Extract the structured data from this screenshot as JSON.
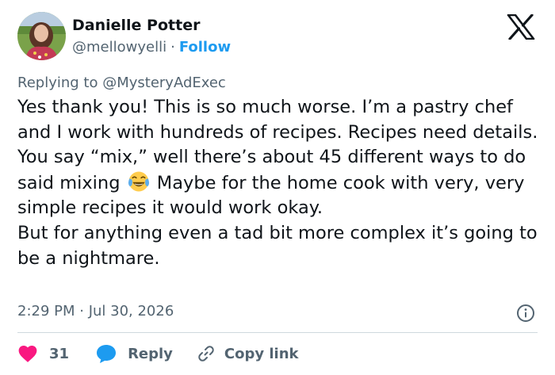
{
  "author": {
    "name": "Danielle Potter",
    "handle": "@mellowyelli",
    "separator": "·",
    "follow_label": "Follow",
    "avatar_icon": "user-avatar-photo"
  },
  "brand": {
    "logo_icon": "x-logo-icon"
  },
  "reply_context": {
    "prefix": "Replying to",
    "mention": "@MysteryAdExec"
  },
  "tweet": {
    "paragraph1_part1": "Yes thank you! This is so much worse. I’m a pastry chef and I work with hundreds of recipes. Recipes need details. You say “mix,” well there’s about 45 different ways to do said mixing",
    "emoji": "face-with-tears-of-joy-emoji",
    "paragraph1_part2": "Maybe for the home cook with very, very simple recipes it would work okay.",
    "paragraph2": "But for anything even a tad bit more complex it’s going to be a nightmare."
  },
  "meta": {
    "timestamp": "2:29 PM · Jul 30, 2026",
    "info_icon": "info-icon"
  },
  "actions": {
    "like_count": "31",
    "reply_label": "Reply",
    "copy_link_label": "Copy link"
  },
  "colors": {
    "like": "#f91880",
    "reply": "#1d9bf0",
    "link": "#1d9bf0",
    "secondary_text": "#536471",
    "primary_text": "#0f1419"
  }
}
